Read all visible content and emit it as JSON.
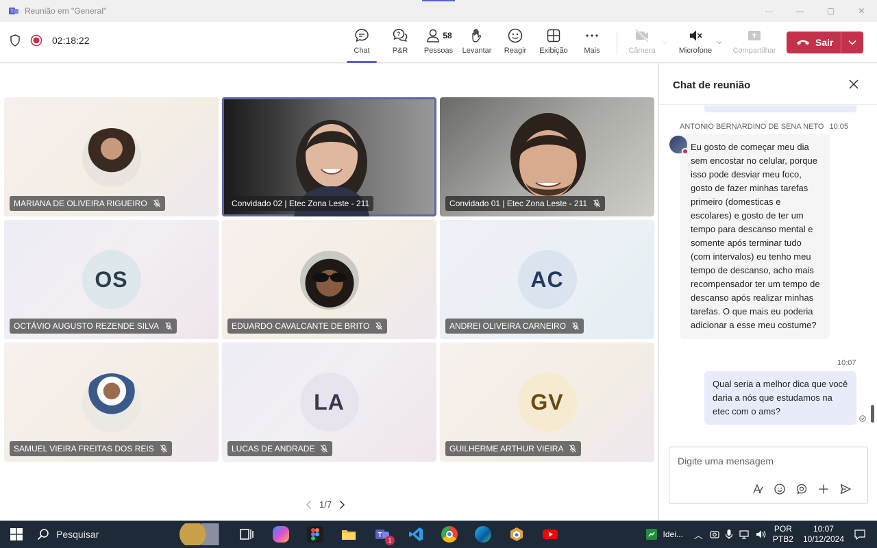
{
  "window": {
    "title": "Reunião em \"General\""
  },
  "toolbar": {
    "timer": "02:18:22",
    "buttons": {
      "chat": "Chat",
      "qa": "P&R",
      "people": "Pessoas",
      "people_count": "58",
      "raise": "Levantar",
      "react": "Reagir",
      "view": "Exibição",
      "more": "Mais",
      "camera": "Câmera",
      "mic": "Microfone",
      "share": "Compartilhar"
    },
    "leave": "Sair"
  },
  "participants": [
    {
      "name": "MARIANA DE OLIVEIRA RIGUEIRO",
      "type": "photo",
      "muted": true
    },
    {
      "name": "Convidado 02 | Etec Zona Leste - 211",
      "type": "video",
      "muted": false,
      "active": true
    },
    {
      "name": "Convidado 01 | Etec Zona Leste - 211",
      "type": "video",
      "muted": true
    },
    {
      "name": "OCTÁVIO AUGUSTO REZENDE SILVA",
      "initials": "OS",
      "type": "initials",
      "muted": true
    },
    {
      "name": "EDUARDO CAVALCANTE DE BRITO",
      "type": "photo",
      "muted": true
    },
    {
      "name": "ANDREI OLIVEIRA CARNEIRO",
      "initials": "AC",
      "type": "initials",
      "muted": true
    },
    {
      "name": "SAMUEL VIEIRA FREITAS DOS REIS",
      "type": "photo",
      "muted": true
    },
    {
      "name": "LUCAS DE ANDRADE",
      "initials": "LA",
      "type": "initials",
      "muted": true
    },
    {
      "name": "GUILHERME ARTHUR VIEIRA",
      "initials": "GV",
      "type": "initials",
      "muted": true
    }
  ],
  "pager": {
    "label": "1/7"
  },
  "chat": {
    "title": "Chat de reunião",
    "messages": [
      {
        "author": "ANTONIO BERNARDINO DE SENA NETO",
        "time": "10:05",
        "text": "Eu gosto de começar meu dia sem encostar no celular, porque isso pode desviar meu foco, gosto de fazer minhas tarefas primeiro (domesticas e escolares) e gosto de ter um tempo para descanso mental e somente após terminar tudo (com intervalos) eu tenho meu tempo de descanso, acho mais recompensador ter um tempo de descanso após realizar minhas tarefas. O que mais eu poderia adicionar a esse meu costume?"
      },
      {
        "author": "",
        "time": "10:07",
        "text": "Qual seria a melhor dica que você daria a nós que estudamos na etec com o ams?"
      }
    ],
    "compose_placeholder": "Digite uma mensagem"
  },
  "taskbar": {
    "search": "Pesquisar",
    "app_label": "Idei...",
    "lang_top": "POR",
    "lang_bottom": "PTB2",
    "time": "10:07",
    "date": "10/12/2024",
    "teams_badge": "1"
  },
  "colors": {
    "accent": "#5b5fc7",
    "leave": "#c4314b",
    "taskbar": "#1f2a38"
  }
}
